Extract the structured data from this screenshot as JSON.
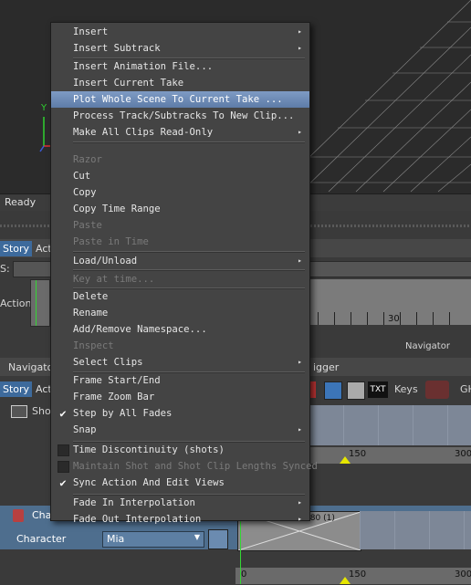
{
  "viewport": {
    "axis_y": "Y",
    "axis_x": "X"
  },
  "status": {
    "text": "Ready"
  },
  "story_panel": {
    "tabs": [
      "Story",
      "Acti"
    ],
    "field_label": "S:",
    "action_label": "Action",
    "ruler_mark": "30",
    "navigator_label": "Navigator"
  },
  "lower_panel": {
    "tabs": [
      "Navigato",
      "igger"
    ],
    "tab_story": "Story",
    "tab_acti": "Acti",
    "keys_label": "Keys",
    "gh_label": "GH",
    "shot_label": "Shot",
    "ruler1_marks": [
      "150",
      "300"
    ],
    "char_label": "Char",
    "clip_text": "Take 002 (0.5) 180 (1)",
    "character_label": "Character",
    "character_value": "Mia",
    "ruler2_marks": [
      "0",
      "150",
      "300"
    ]
  },
  "menu": {
    "items": [
      {
        "label": "Insert",
        "submenu": true
      },
      {
        "label": "Insert Subtrack",
        "submenu": true
      },
      {
        "sep": true
      },
      {
        "label": "Insert Animation File..."
      },
      {
        "label": "Insert Current Take"
      },
      {
        "label": "Plot Whole Scene To Current Take ...",
        "selected": true
      },
      {
        "label": "Process Track/Subtracks To New Clip..."
      },
      {
        "label": "Make All Clips Read-Only",
        "submenu": true
      },
      {
        "sep": true
      },
      {
        "label": "Razor",
        "disabled": true
      },
      {
        "label": "Cut"
      },
      {
        "label": "Copy"
      },
      {
        "label": "Copy Time Range"
      },
      {
        "label": "Paste",
        "disabled": true
      },
      {
        "label": "Paste in Time",
        "disabled": true
      },
      {
        "sep": true
      },
      {
        "label": "Load/Unload",
        "submenu": true
      },
      {
        "sep": true
      },
      {
        "label": "Key at time...",
        "disabled": true
      },
      {
        "sep": true
      },
      {
        "label": "Delete"
      },
      {
        "label": "Rename"
      },
      {
        "label": "Add/Remove Namespace..."
      },
      {
        "label": "Inspect",
        "disabled": true
      },
      {
        "label": "Select Clips",
        "submenu": true
      },
      {
        "sep": true
      },
      {
        "label": "Frame Start/End"
      },
      {
        "label": "Frame Zoom Bar"
      },
      {
        "label": "Step by All Fades",
        "check": "checked"
      },
      {
        "label": "Snap",
        "submenu": true
      },
      {
        "sep": true
      },
      {
        "label": "Time Discontinuity (shots)",
        "check": "box"
      },
      {
        "label": "Maintain Shot and Shot Clip Lengths Synced",
        "check": "box",
        "disabled": true
      },
      {
        "label": "Sync Action And Edit Views",
        "check": "checked"
      },
      {
        "sep": true
      },
      {
        "label": "Fade In Interpolation",
        "submenu": true
      },
      {
        "label": "Fade Out Interpolation",
        "submenu": true
      }
    ]
  }
}
